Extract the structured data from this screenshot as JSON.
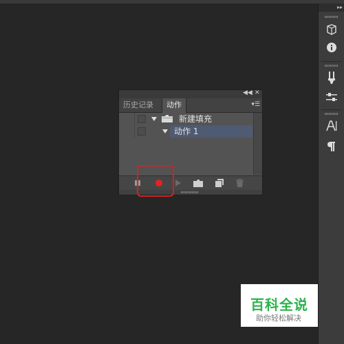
{
  "panel": {
    "tabs": [
      {
        "label": "历史记录",
        "active": false
      },
      {
        "label": "动作",
        "active": true
      }
    ],
    "actions": [
      {
        "label": "新建填充",
        "type": "set",
        "expanded": true
      },
      {
        "label": "动作 1",
        "type": "action",
        "expanded": true,
        "selected": true
      }
    ],
    "bottom_buttons": [
      "stop-icon",
      "record-icon",
      "play-icon",
      "folder-icon",
      "new-action-icon",
      "trash-icon"
    ]
  },
  "dock": {
    "icons": [
      "3d-icon",
      "info-icon",
      "brush-icon",
      "adjust-icon",
      "character-icon",
      "paragraph-icon"
    ]
  },
  "watermark": {
    "title": "百科全说",
    "subtitle": "助你轻松解决"
  },
  "colors": {
    "record": "#e52222",
    "highlight": "#d42222",
    "selected_row": "#4f5b72",
    "watermark_green": "#2bb24c"
  }
}
